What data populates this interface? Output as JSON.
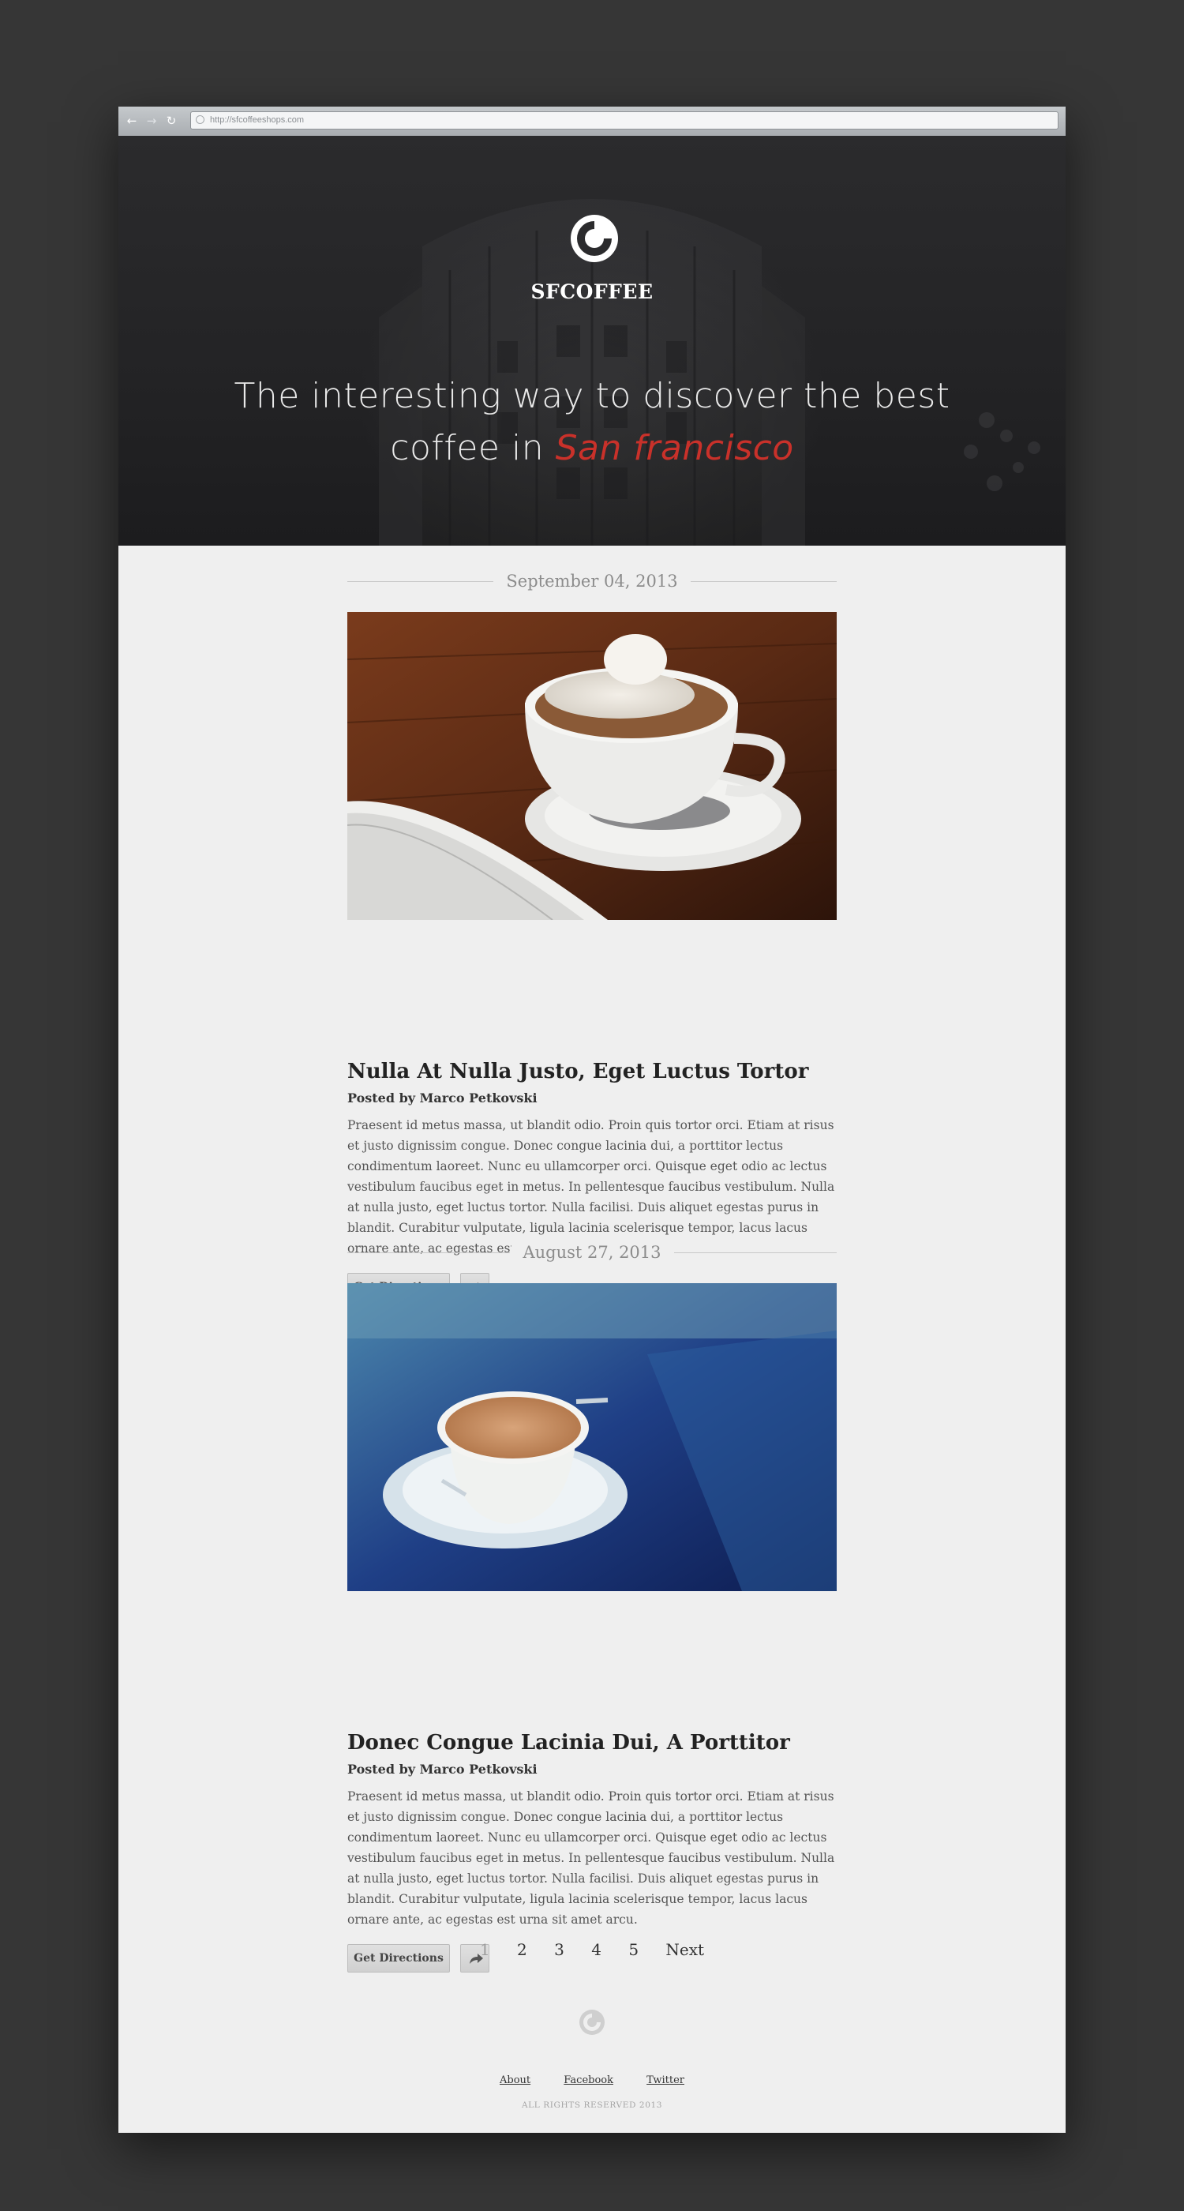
{
  "browser": {
    "url": "http://sfcoffeeshops.com"
  },
  "hero": {
    "brand": "SFCOFFEE",
    "tagline_line1": "The interesting way to discover the best",
    "tagline_line2_prefix": "coffee in ",
    "tagline_accent": "San francisco",
    "accent_color": "#c9312a"
  },
  "posts": [
    {
      "date": "September 04, 2013",
      "title": "Nulla At Nulla Justo, Eget Luctus Tortor",
      "author": "Posted by Marco Petkovski",
      "body": "Praesent id metus massa, ut blandit odio. Proin quis tortor orci. Etiam at risus et justo dignissim congue. Donec congue lacinia dui, a porttitor lectus condimentum laoreet. Nunc eu ullamcorper orci. Quisque eget odio ac lectus vestibulum faucibus eget in metus. In pellentesque faucibus vestibulum. Nulla at nulla justo, eget luctus tortor. Nulla facilisi. Duis aliquet egestas purus in blandit. Curabitur vulputate, ligula lacinia scelerisque tempor, lacus lacus ornare ante, ac egestas est urna sit amet arcu.",
      "button": "Get Directions"
    },
    {
      "date": "August 27, 2013",
      "title": "Donec Congue Lacinia Dui, A Porttitor",
      "author": "Posted by Marco Petkovski",
      "body": "Praesent id metus massa, ut blandit odio. Proin quis tortor orci. Etiam at risus et justo dignissim congue. Donec congue lacinia dui, a porttitor lectus condimentum laoreet. Nunc eu ullamcorper orci. Quisque eget odio ac lectus vestibulum faucibus eget in metus. In pellentesque faucibus vestibulum. Nulla at nulla justo, eget luctus tortor. Nulla facilisi. Duis aliquet egestas purus in blandit. Curabitur vulputate, ligula lacinia scelerisque tempor, lacus lacus ornare ante, ac egestas est urna sit amet arcu.",
      "button": "Get Directions"
    }
  ],
  "pagination": {
    "pages": [
      "1",
      "2",
      "3",
      "4",
      "5"
    ],
    "current": "1",
    "next": "Next"
  },
  "footer": {
    "links": [
      "About",
      "Facebook",
      "Twitter"
    ],
    "copyright": "ALL RIGHTS RESERVED 2013"
  }
}
